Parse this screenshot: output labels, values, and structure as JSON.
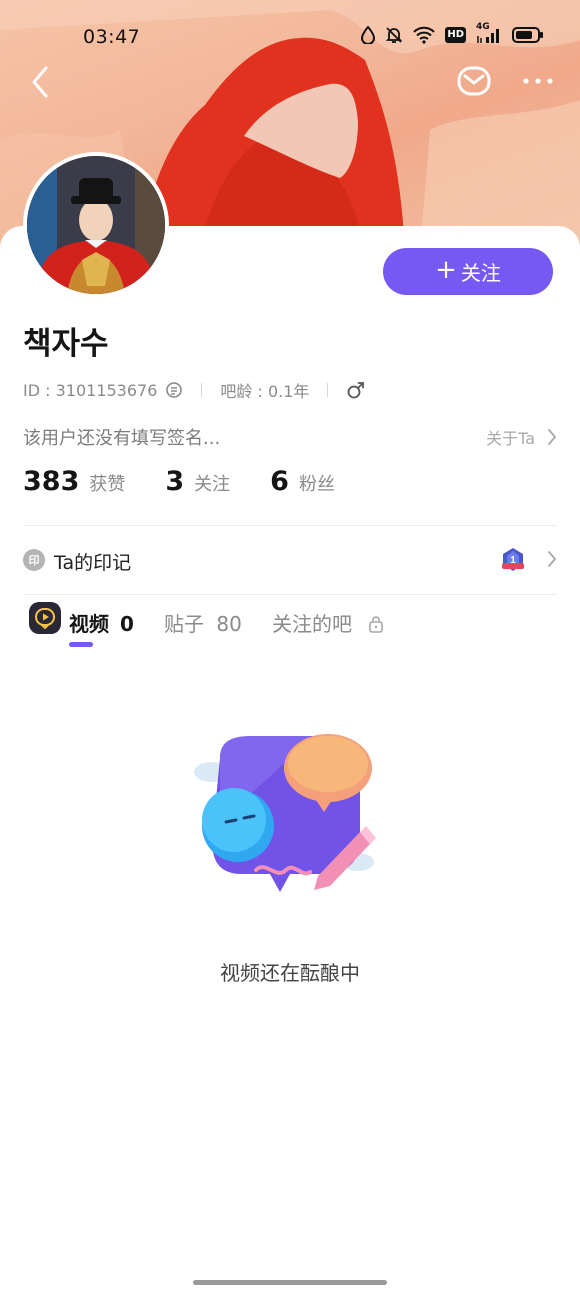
{
  "status_bar": {
    "time": "03:47",
    "icons": [
      "water-drop-icon",
      "bell-muted-icon",
      "wifi-icon",
      "hd-icon",
      "4g-signal-icon",
      "battery-icon"
    ],
    "hd_label": "HD",
    "network_label": "4G"
  },
  "header": {
    "back_icon": "chevron-left-icon",
    "mail_icon": "mail-icon",
    "more_icon": "more-dots-icon"
  },
  "profile": {
    "username": "책자수",
    "follow_button": "关注",
    "id_text": "ID : 3101153676",
    "age_text": "吧龄 : 0.1年",
    "gender_icon": "male-icon",
    "signature": "该用户还没有填写签名...",
    "about_link": "关于Ta"
  },
  "stats": [
    {
      "value": "383",
      "label": "获赞"
    },
    {
      "value": "3",
      "label": "关注"
    },
    {
      "value": "6",
      "label": "粉丝"
    }
  ],
  "imprint": {
    "badge": "印",
    "title": "Ta的印记",
    "medal_number": "1"
  },
  "tabs": [
    {
      "label": "视频",
      "count": "0",
      "active": true
    },
    {
      "label": "贴子",
      "count": "80",
      "active": false
    },
    {
      "label": "关注的吧",
      "count": "",
      "active": false,
      "icon": "lock-icon"
    }
  ],
  "empty_state": {
    "message": "视频还在酝酿中"
  },
  "colors": {
    "accent": "#7559f2",
    "banner": "#f3b89c",
    "banner_shape": "#e0321e"
  }
}
